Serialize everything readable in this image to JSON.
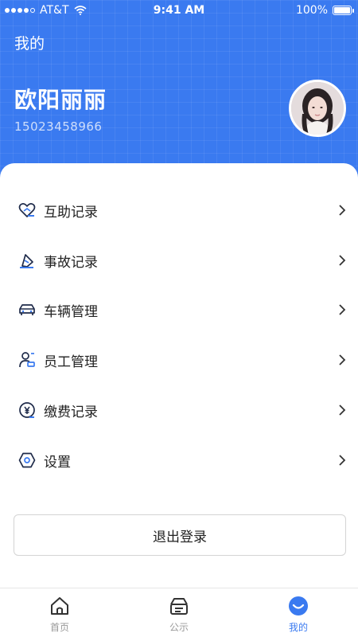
{
  "status_bar": {
    "carrier": "AT&T",
    "time": "9:41 AM",
    "battery": "100%"
  },
  "header": {
    "title": "我的",
    "user_name": "欧阳丽丽",
    "phone": "15023458966"
  },
  "menu": {
    "items": [
      {
        "label": "互助记录",
        "icon": "heart-hands-icon"
      },
      {
        "label": "事故记录",
        "icon": "accident-icon"
      },
      {
        "label": "车辆管理",
        "icon": "car-icon"
      },
      {
        "label": "员工管理",
        "icon": "staff-icon"
      },
      {
        "label": "缴费记录",
        "icon": "yuan-coin-icon"
      },
      {
        "label": "设置",
        "icon": "settings-hexagon-icon"
      }
    ]
  },
  "logout": {
    "label": "退出登录"
  },
  "tabbar": {
    "items": [
      {
        "label": "首页",
        "icon": "home-icon"
      },
      {
        "label": "公示",
        "icon": "notice-box-icon"
      },
      {
        "label": "我的",
        "icon": "profile-smile-icon"
      }
    ],
    "active_index": 2
  },
  "colors": {
    "primary": "#3a7af0",
    "text": "#222222",
    "muted": "#999999"
  }
}
